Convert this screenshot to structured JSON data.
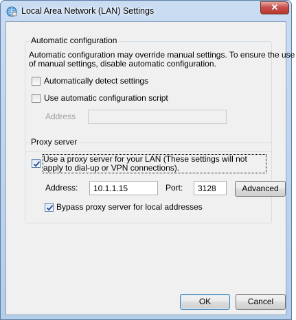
{
  "window": {
    "title": "Local Area Network (LAN) Settings",
    "close_symbol": "✕"
  },
  "auto_config": {
    "legend": "Automatic configuration",
    "description": "Automatic configuration may override manual settings.  To ensure the use of manual settings, disable automatic configuration.",
    "auto_detect_label": "Automatically detect settings",
    "auto_detect_checked": false,
    "use_script_label": "Use automatic configuration script",
    "use_script_checked": false,
    "address_label": "Address",
    "address_value": ""
  },
  "proxy": {
    "legend": "Proxy server",
    "use_proxy_label": "Use a proxy server for your LAN (These settings will not apply to dial-up or VPN connections).",
    "use_proxy_checked": true,
    "address_label": "Address:",
    "address_value": "10.1.1.15",
    "port_label": "Port:",
    "port_value": "3128",
    "advanced_label": "Advanced",
    "bypass_label": "Bypass proxy server for local addresses",
    "bypass_checked": true
  },
  "buttons": {
    "ok_label": "OK",
    "cancel_label": "Cancel"
  },
  "icons": {
    "title_icon": "network-globe-icon",
    "check_icon": "checkmark-icon"
  }
}
